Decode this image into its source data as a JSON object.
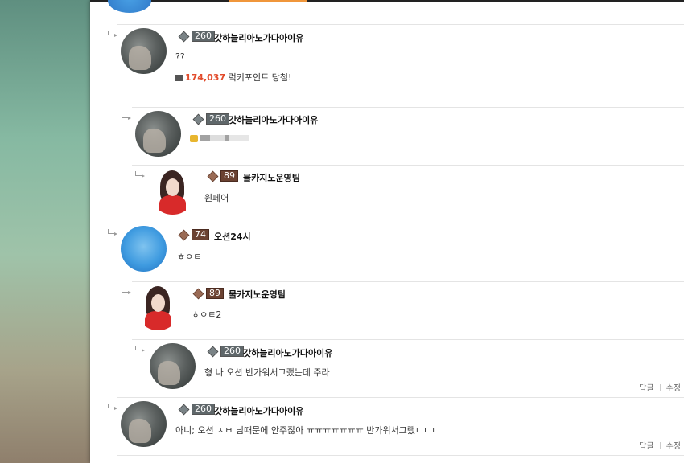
{
  "comments": [
    {
      "nick": "갓하늘리아노가다아이유",
      "level": "260",
      "text": "??",
      "points": "174,037",
      "points_suffix": " 럭키포인트 당첨!"
    },
    {
      "nick": "갓하늘리아노가다아이유",
      "level": "260"
    },
    {
      "nick": "물카지노운영팀",
      "level": "89",
      "text": "원페어"
    },
    {
      "nick": "오션24시",
      "level": "74",
      "text": "ㅎㅇㅌ"
    },
    {
      "nick": "물카지노운영팀",
      "level": "89",
      "text": "ㅎㅇㅌ2"
    },
    {
      "nick": "갓하늘리아노가다아이유",
      "level": "260",
      "text": "형 나 오션 반가워서그랬는데 주라",
      "reply": "답글",
      "edit": "수정"
    },
    {
      "nick": "갓하늘리아노가다아이유",
      "level": "260",
      "text": "아니; 오션 ㅅㅂ 님때문에 안주잖아 ㅠㅠㅠㅠㅠㅠㅠ 반가워서그랬ㄴㄴㄷ",
      "reply": "답글",
      "edit": "수정"
    }
  ],
  "colors": {
    "accent": "#f0963b",
    "points": "#e24b2b"
  },
  "icons": {
    "reply": "reply-arrow-icon",
    "level": "level-badge-icon",
    "gift": "gift-icon",
    "lock": "lock-icon"
  }
}
